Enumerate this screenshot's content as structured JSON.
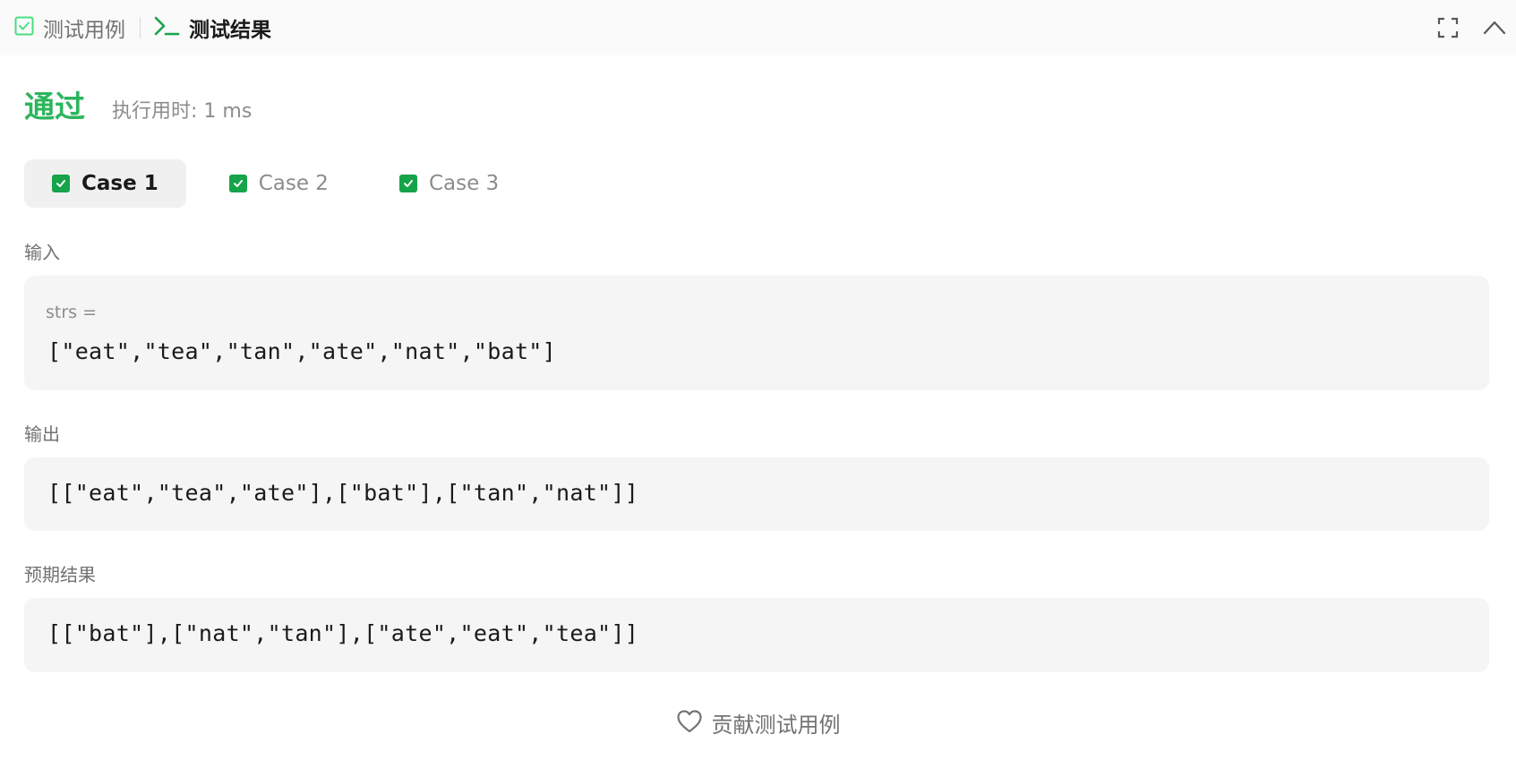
{
  "tabs": {
    "testcase_label": "测试用例",
    "result_label": "测试结果"
  },
  "status": {
    "verdict": "通过",
    "runtime": "执行用时: 1 ms"
  },
  "cases": [
    {
      "label": "Case 1",
      "active": true
    },
    {
      "label": "Case 2",
      "active": false
    },
    {
      "label": "Case 3",
      "active": false
    }
  ],
  "input": {
    "section_label": "输入",
    "var_name": "strs =",
    "value": "[\"eat\",\"tea\",\"tan\",\"ate\",\"nat\",\"bat\"]"
  },
  "output": {
    "section_label": "输出",
    "value": "[[\"eat\",\"tea\",\"ate\"],[\"bat\"],[\"tan\",\"nat\"]]"
  },
  "expected": {
    "section_label": "预期结果",
    "value": "[[\"bat\"],[\"nat\",\"tan\"],[\"ate\",\"eat\",\"tea\"]]"
  },
  "contribute_label": "贡献测试用例",
  "colors": {
    "accept_green": "#2db55d",
    "checkbox_green": "#16a34a",
    "terminal_green": "#16a34a",
    "box_bg": "#f5f5f5"
  },
  "icons": [
    "checkbox-icon",
    "terminal-icon",
    "fullscreen-icon",
    "chevron-up-icon",
    "heart-icon"
  ]
}
